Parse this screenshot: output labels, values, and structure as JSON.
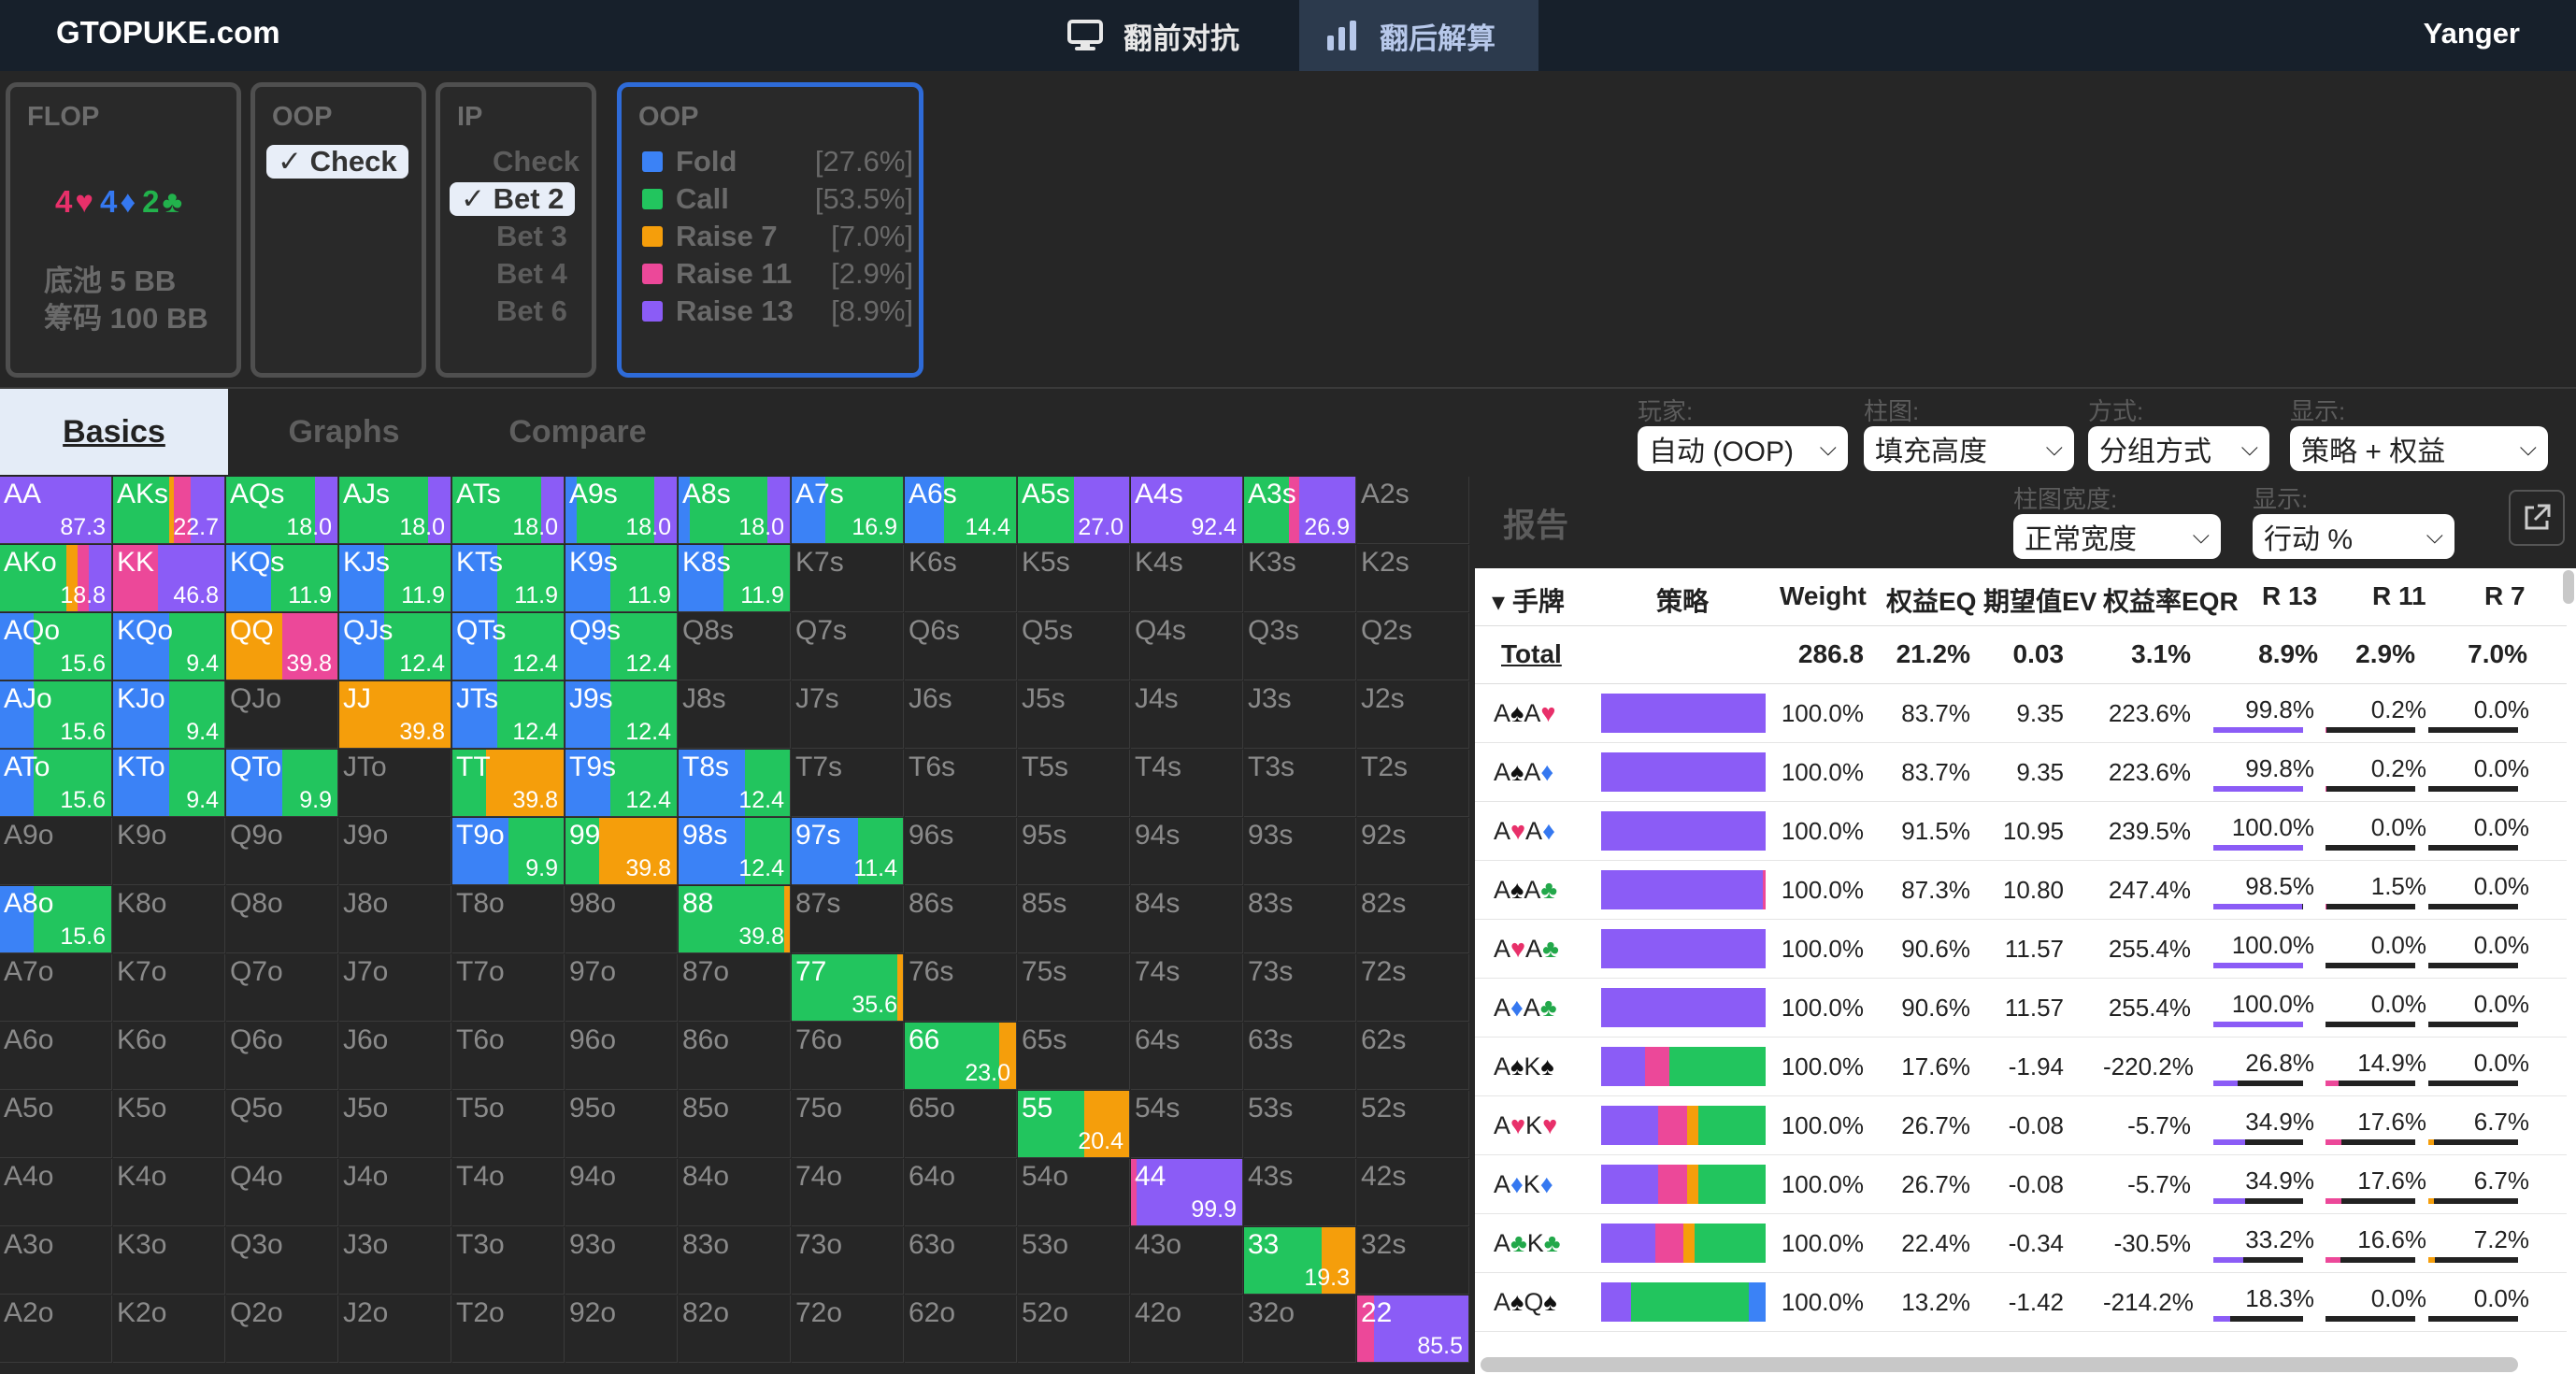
{
  "nav": {
    "brand": "GTOPUKE.com",
    "tabs": [
      {
        "label": "翻前对抗",
        "icon": "monitor-icon"
      },
      {
        "label": "翻后解算",
        "icon": "bar-chart-icon"
      }
    ],
    "user": "Yanger"
  },
  "flop": {
    "title": "FLOP",
    "cards": [
      {
        "rank": "4",
        "suit": "♥",
        "color": "#e8306a"
      },
      {
        "rank": "4",
        "suit": "♦",
        "color": "#3578f0"
      },
      {
        "rank": "2",
        "suit": "♣",
        "color": "#22b24c"
      }
    ],
    "pot": "底池 5 BB",
    "stack": "筹码 100 BB"
  },
  "oop": {
    "title": "OOP",
    "options": [
      "✓ Check"
    ]
  },
  "ip": {
    "title": "IP",
    "options": [
      "Check",
      "✓ Bet 2",
      "Bet 3",
      "Bet 4",
      "Bet 6"
    ]
  },
  "actions": {
    "title": "OOP",
    "rows": [
      {
        "label": "Fold",
        "pct": "[27.6%]",
        "color": "#3b82f6"
      },
      {
        "label": "Call",
        "pct": "[53.5%]",
        "color": "#22c55e"
      },
      {
        "label": "Raise 7",
        "pct": "[7.0%]",
        "color": "#f59e0b"
      },
      {
        "label": "Raise 11",
        "pct": "[2.9%]",
        "color": "#ec4899"
      },
      {
        "label": "Raise 13",
        "pct": "[8.9%]",
        "color": "#8b5cf6"
      }
    ]
  },
  "tabs": [
    "Basics",
    "Graphs",
    "Compare"
  ],
  "controls": [
    {
      "label": "玩家:",
      "value": "自动 (OOP)"
    },
    {
      "label": "柱图:",
      "value": "填充高度"
    },
    {
      "label": "方式:",
      "value": "分组方式"
    },
    {
      "label": "显示:",
      "value": "策略 + 权益"
    }
  ],
  "report_controls": [
    {
      "label": "柱图宽度:",
      "value": "正常宽度"
    },
    {
      "label": "显示:",
      "value": "行动 %"
    }
  ],
  "report": {
    "title": "报告",
    "columns": [
      "▾ 手牌",
      "策略",
      "Weight",
      "权益EQ",
      "期望值EV",
      "权益率EQR",
      "R 13",
      "R 11",
      "R 7"
    ],
    "total": {
      "label": "Total",
      "weight": "286.8",
      "eq": "21.2%",
      "ev": "0.03",
      "eqr": "3.1%",
      "r13": "8.9%",
      "r11": "2.9%",
      "r7": "7.0%"
    },
    "rows": [
      {
        "hand": [
          [
            "A",
            "♠"
          ],
          [
            "A",
            "♥"
          ]
        ],
        "strat": [
          0,
          0,
          0,
          0,
          100
        ],
        "weight": "100.0%",
        "eq": "83.7%",
        "ev": "9.35",
        "eqr": "223.6%",
        "r13": "99.8%",
        "r11": "0.2%",
        "r7": "0.0%"
      },
      {
        "hand": [
          [
            "A",
            "♠"
          ],
          [
            "A",
            "♦"
          ]
        ],
        "strat": [
          0,
          0,
          0,
          0,
          100
        ],
        "weight": "100.0%",
        "eq": "83.7%",
        "ev": "9.35",
        "eqr": "223.6%",
        "r13": "99.8%",
        "r11": "0.2%",
        "r7": "0.0%"
      },
      {
        "hand": [
          [
            "A",
            "♥"
          ],
          [
            "A",
            "♦"
          ]
        ],
        "strat": [
          0,
          0,
          0,
          0,
          100
        ],
        "weight": "100.0%",
        "eq": "91.5%",
        "ev": "10.95",
        "eqr": "239.5%",
        "r13": "100.0%",
        "r11": "0.0%",
        "r7": "0.0%"
      },
      {
        "hand": [
          [
            "A",
            "♠"
          ],
          [
            "A",
            "♣"
          ]
        ],
        "strat": [
          0,
          0,
          0,
          1.5,
          98.5
        ],
        "weight": "100.0%",
        "eq": "87.3%",
        "ev": "10.80",
        "eqr": "247.4%",
        "r13": "98.5%",
        "r11": "1.5%",
        "r7": "0.0%"
      },
      {
        "hand": [
          [
            "A",
            "♥"
          ],
          [
            "A",
            "♣"
          ]
        ],
        "strat": [
          0,
          0,
          0,
          0,
          100
        ],
        "weight": "100.0%",
        "eq": "90.6%",
        "ev": "11.57",
        "eqr": "255.4%",
        "r13": "100.0%",
        "r11": "0.0%",
        "r7": "0.0%"
      },
      {
        "hand": [
          [
            "A",
            "♦"
          ],
          [
            "A",
            "♣"
          ]
        ],
        "strat": [
          0,
          0,
          0,
          0,
          100
        ],
        "weight": "100.0%",
        "eq": "90.6%",
        "ev": "11.57",
        "eqr": "255.4%",
        "r13": "100.0%",
        "r11": "0.0%",
        "r7": "0.0%"
      },
      {
        "hand": [
          [
            "A",
            "♠"
          ],
          [
            "K",
            "♠"
          ]
        ],
        "strat": [
          0,
          58.3,
          0,
          14.9,
          26.8
        ],
        "weight": "100.0%",
        "eq": "17.6%",
        "ev": "-1.94",
        "eqr": "-220.2%",
        "r13": "26.8%",
        "r11": "14.9%",
        "r7": "0.0%"
      },
      {
        "hand": [
          [
            "A",
            "♥"
          ],
          [
            "K",
            "♥"
          ]
        ],
        "strat": [
          0,
          40.8,
          6.7,
          17.6,
          34.9
        ],
        "weight": "100.0%",
        "eq": "26.7%",
        "ev": "-0.08",
        "eqr": "-5.7%",
        "r13": "34.9%",
        "r11": "17.6%",
        "r7": "6.7%"
      },
      {
        "hand": [
          [
            "A",
            "♦"
          ],
          [
            "K",
            "♦"
          ]
        ],
        "strat": [
          0,
          40.8,
          6.7,
          17.6,
          34.9
        ],
        "weight": "100.0%",
        "eq": "26.7%",
        "ev": "-0.08",
        "eqr": "-5.7%",
        "r13": "34.9%",
        "r11": "17.6%",
        "r7": "6.7%"
      },
      {
        "hand": [
          [
            "A",
            "♣"
          ],
          [
            "K",
            "♣"
          ]
        ],
        "strat": [
          0,
          43,
          7.2,
          16.6,
          33.2
        ],
        "weight": "100.0%",
        "eq": "22.4%",
        "ev": "-0.34",
        "eqr": "-30.5%",
        "r13": "33.2%",
        "r11": "16.6%",
        "r7": "7.2%"
      },
      {
        "hand": [
          [
            "A",
            "♠"
          ],
          [
            "Q",
            "♠"
          ]
        ],
        "strat": [
          10.5,
          71.2,
          0,
          0,
          18.3
        ],
        "weight": "100.0%",
        "eq": "13.2%",
        "ev": "-1.42",
        "eqr": "-214.2%",
        "r13": "18.3%",
        "r11": "0.0%",
        "r7": "0.0%"
      }
    ]
  },
  "suit_colors": {
    "♠": "#111111",
    "♥": "#e8306a",
    "♦": "#3578f0",
    "♣": "#22a84a"
  },
  "matrix": {
    "ranks": [
      "A",
      "K",
      "Q",
      "J",
      "T",
      "9",
      "8",
      "7",
      "6",
      "5",
      "4",
      "3",
      "2"
    ],
    "action_colors": [
      "#3b82f6",
      "#22c55e",
      "#f59e0b",
      "#ec4899",
      "#8b5cf6"
    ],
    "cells": {
      "AA": {
        "v": "87.3",
        "s": [
          0,
          0,
          0,
          0,
          100
        ]
      },
      "AKs": {
        "v": "22.7",
        "s": [
          0,
          50,
          5,
          15,
          30
        ]
      },
      "AQs": {
        "v": "18.0",
        "s": [
          0,
          80,
          0,
          0,
          20
        ]
      },
      "AJs": {
        "v": "18.0",
        "s": [
          0,
          80,
          0,
          0,
          20
        ]
      },
      "ATs": {
        "v": "18.0",
        "s": [
          0,
          80,
          0,
          0,
          20
        ]
      },
      "A9s": {
        "v": "18.0",
        "s": [
          10,
          70,
          0,
          0,
          20
        ]
      },
      "A8s": {
        "v": "18.0",
        "s": [
          10,
          70,
          0,
          0,
          20
        ]
      },
      "A7s": {
        "v": "16.9",
        "s": [
          30,
          70,
          0,
          0,
          0
        ]
      },
      "A6s": {
        "v": "14.4",
        "s": [
          35,
          65,
          0,
          0,
          0
        ]
      },
      "A5s": {
        "v": "27.0",
        "s": [
          0,
          50,
          0,
          0,
          50
        ]
      },
      "A4s": {
        "v": "92.4",
        "s": [
          0,
          0,
          0,
          0,
          100
        ]
      },
      "A3s": {
        "v": "26.9",
        "s": [
          0,
          40,
          0,
          10,
          50
        ]
      },
      "AKo": {
        "v": "18.8",
        "s": [
          0,
          60,
          10,
          10,
          20
        ]
      },
      "KK": {
        "v": "46.8",
        "s": [
          0,
          0,
          0,
          40,
          60
        ]
      },
      "KQs": {
        "v": "11.9",
        "s": [
          40,
          60,
          0,
          0,
          0
        ]
      },
      "KJs": {
        "v": "11.9",
        "s": [
          40,
          60,
          0,
          0,
          0
        ]
      },
      "KTs": {
        "v": "11.9",
        "s": [
          40,
          60,
          0,
          0,
          0
        ]
      },
      "K9s": {
        "v": "11.9",
        "s": [
          40,
          60,
          0,
          0,
          0
        ]
      },
      "K8s": {
        "v": "11.9",
        "s": [
          40,
          60,
          0,
          0,
          0
        ]
      },
      "AQo": {
        "v": "15.6",
        "s": [
          30,
          70,
          0,
          0,
          0
        ]
      },
      "KQo": {
        "v": "9.4",
        "s": [
          50,
          50,
          0,
          0,
          0
        ]
      },
      "QQ": {
        "v": "39.8",
        "s": [
          0,
          0,
          50,
          50,
          0
        ]
      },
      "QJs": {
        "v": "12.4",
        "s": [
          40,
          60,
          0,
          0,
          0
        ]
      },
      "QTs": {
        "v": "12.4",
        "s": [
          40,
          60,
          0,
          0,
          0
        ]
      },
      "Q9s": {
        "v": "12.4",
        "s": [
          40,
          60,
          0,
          0,
          0
        ]
      },
      "AJo": {
        "v": "15.6",
        "s": [
          30,
          70,
          0,
          0,
          0
        ]
      },
      "KJo": {
        "v": "9.4",
        "s": [
          50,
          50,
          0,
          0,
          0
        ]
      },
      "JJ": {
        "v": "39.8",
        "s": [
          0,
          0,
          100,
          0,
          0
        ]
      },
      "JTs": {
        "v": "12.4",
        "s": [
          40,
          60,
          0,
          0,
          0
        ]
      },
      "J9s": {
        "v": "12.4",
        "s": [
          40,
          60,
          0,
          0,
          0
        ]
      },
      "ATo": {
        "v": "15.6",
        "s": [
          30,
          70,
          0,
          0,
          0
        ]
      },
      "KTo": {
        "v": "9.4",
        "s": [
          50,
          50,
          0,
          0,
          0
        ]
      },
      "QTo": {
        "v": "9.9",
        "s": [
          50,
          50,
          0,
          0,
          0
        ]
      },
      "TT": {
        "v": "39.8",
        "s": [
          0,
          30,
          70,
          0,
          0
        ]
      },
      "T9s": {
        "v": "12.4",
        "s": [
          40,
          60,
          0,
          0,
          0
        ]
      },
      "T8s": {
        "v": "12.4",
        "s": [
          60,
          40,
          0,
          0,
          0
        ]
      },
      "T9o": {
        "v": "9.9",
        "s": [
          50,
          50,
          0,
          0,
          0
        ]
      },
      "99": {
        "v": "39.8",
        "s": [
          0,
          30,
          70,
          0,
          0
        ]
      },
      "98s": {
        "v": "12.4",
        "s": [
          60,
          40,
          0,
          0,
          0
        ]
      },
      "97s": {
        "v": "11.4",
        "s": [
          60,
          40,
          0,
          0,
          0
        ]
      },
      "A8o": {
        "v": "15.6",
        "s": [
          30,
          70,
          0,
          0,
          0
        ]
      },
      "88": {
        "v": "39.8",
        "s": [
          0,
          95,
          5,
          0,
          0
        ]
      },
      "77": {
        "v": "35.6",
        "s": [
          0,
          95,
          5,
          0,
          0
        ]
      },
      "66": {
        "v": "23.0",
        "s": [
          0,
          85,
          15,
          0,
          0
        ]
      },
      "55": {
        "v": "20.4",
        "s": [
          0,
          60,
          40,
          0,
          0
        ]
      },
      "44": {
        "v": "99.9",
        "s": [
          0,
          0,
          0,
          5,
          95
        ]
      },
      "33": {
        "v": "19.3",
        "s": [
          0,
          70,
          30,
          0,
          0
        ]
      },
      "22": {
        "v": "85.5",
        "s": [
          0,
          0,
          0,
          15,
          85
        ]
      }
    }
  }
}
